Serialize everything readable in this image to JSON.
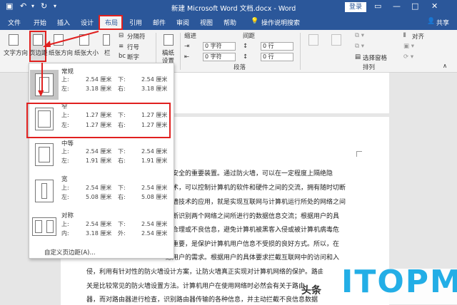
{
  "window": {
    "title": "新建 Microsoft Word 文档.docx - Word",
    "login_label": "登录",
    "quick_access": [
      "save",
      "undo",
      "redo",
      "customize"
    ]
  },
  "tabs": {
    "file": "文件",
    "home": "开始",
    "insert": "插入",
    "design": "设计",
    "layout": "布局",
    "references": "引用",
    "mailings": "邮件",
    "review": "审阅",
    "view": "视图",
    "help": "帮助",
    "tell_me": "操作说明搜索",
    "share": "共享"
  },
  "ribbon": {
    "text_direction": "文字方向",
    "margins": "页边距",
    "orientation": "纸张方向",
    "size": "纸张大小",
    "columns": "栏",
    "breaks": "分隔符",
    "line_numbers": "行号",
    "hyphenation": "断字",
    "draft": "稿纸",
    "draft_settings": "设置",
    "indent": "缩进",
    "spacing": "间距",
    "indent_left": "0 字符",
    "indent_right": "0 字符",
    "spacing_before": "0 行",
    "spacing_after": "0 行",
    "group_paragraph": "段落",
    "align": "对齐",
    "selection_pane": "选择窗格",
    "arrange": "排列",
    "group_arrange": "排列"
  },
  "margins_menu": {
    "options": [
      {
        "name": "常规",
        "top_label": "上:",
        "top": "2.54 厘米",
        "bottom_label": "下:",
        "bottom": "2.54 厘米",
        "left_label": "左:",
        "left": "3.18 厘米",
        "right_label": "右:",
        "right": "3.18 厘米"
      },
      {
        "name": "窄",
        "top_label": "上:",
        "top": "1.27 厘米",
        "bottom_label": "下:",
        "bottom": "1.27 厘米",
        "left_label": "左:",
        "left": "1.27 厘米",
        "right_label": "右:",
        "right": "1.27 厘米"
      },
      {
        "name": "中等",
        "top_label": "上:",
        "top": "2.54 厘米",
        "bottom_label": "下:",
        "bottom": "2.54 厘米",
        "left_label": "左:",
        "left": "1.91 厘米",
        "right_label": "右:",
        "right": "1.91 厘米"
      },
      {
        "name": "宽",
        "top_label": "上:",
        "top": "2.54 厘米",
        "bottom_label": "下:",
        "bottom": "2.54 厘米",
        "left_label": "左:",
        "left": "5.08 厘米",
        "right_label": "右:",
        "right": "5.08 厘米"
      },
      {
        "name": "对称",
        "top_label": "上:",
        "top": "2.54 厘米",
        "bottom_label": "下:",
        "bottom": "2.54 厘米",
        "left_label": "内:",
        "left": "3.18 厘米",
        "right_label": "外:",
        "right": "2.54 厘米"
      }
    ],
    "custom": "自定义页边距(A)..."
  },
  "document": {
    "lines": [
      "络安全的重要装置。通过防火墙，可以在一定程度上隔绝隐",
      "技术，可以控制计算机的软件和硬件之间的交流，拥有随时切断",
      "火墙技术的应用，就是实现互联网与计算机运行所处的网络之间",
      "判断识别两个网络之间所进行的数据信息交流；根据用户的具",
      "不合理或不良信息，避免计算机被黑客入侵或被计算机病毒危",
      "关重要，是保护计算机用户信息不受损的良好方式。所以，在",
      "虑用户的需求。根据用户的具体要求拦截互联网中的访问和入",
      "侵，利用有针对性的防火墙设计方案，让防火墙真正实现对计算机网络的保护。路由",
      "关是比较常见的防火墙设置方法。计算机用户在使用网络时必然会有关于路由",
      "器，而对路由器进行检查，识别路由器传输的各种信息，并主动拦截不良信息数据"
    ]
  },
  "watermark": {
    "source": "头条",
    "logo": "ITOPM"
  },
  "colors": {
    "titlebar": "#2b579a",
    "highlight": "#e0201f",
    "logo": "#23aee6"
  }
}
